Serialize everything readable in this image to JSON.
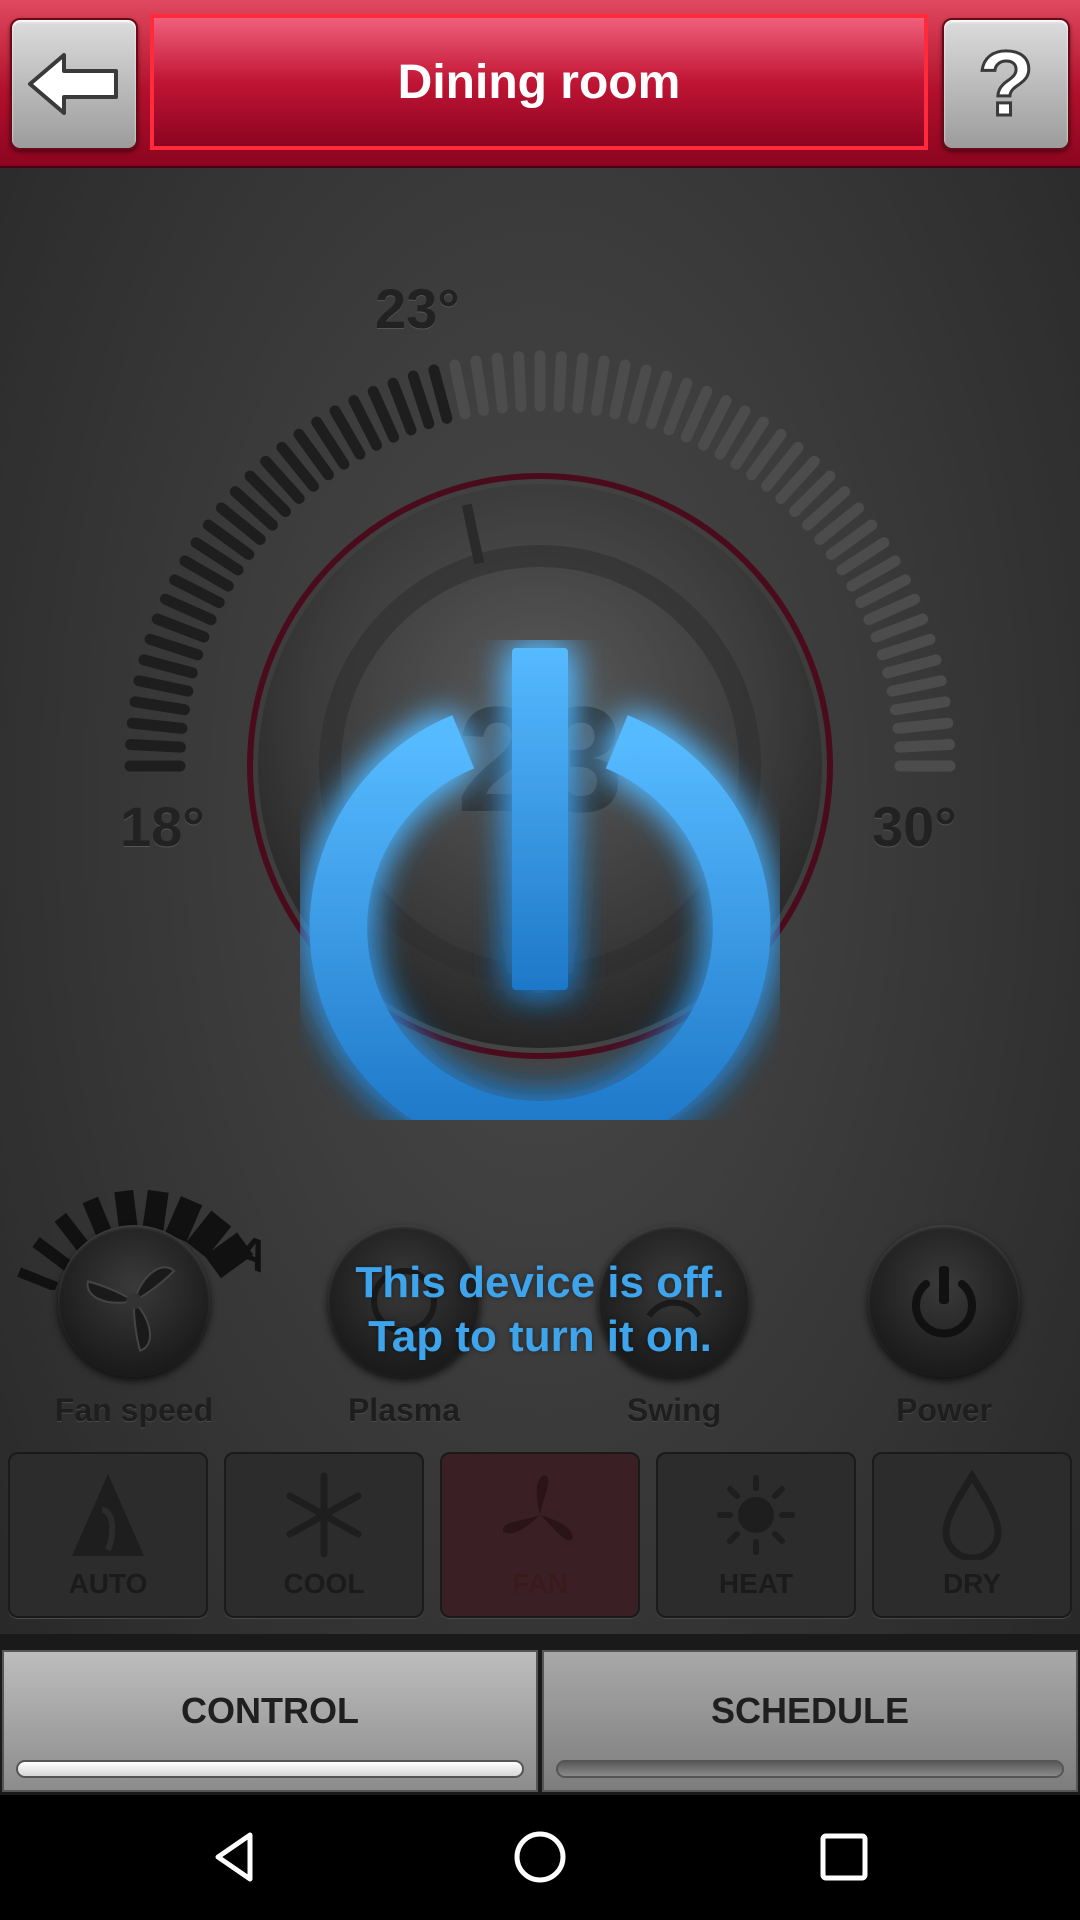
{
  "header": {
    "title": "Dining room",
    "help_label": "?"
  },
  "dial": {
    "setpoint_label": "23°",
    "min_label": "18°",
    "max_label": "30°",
    "center_value": "23",
    "setpoint": 23,
    "min": 18,
    "max": 30
  },
  "overlay": {
    "line1": "This device is off.",
    "line2": "Tap to turn it on."
  },
  "features": [
    {
      "label": "Fan speed",
      "icon": "fan-icon"
    },
    {
      "label": "Plasma",
      "icon": "plasma-icon"
    },
    {
      "label": "Swing",
      "icon": "swing-icon"
    },
    {
      "label": "Power",
      "icon": "power-icon"
    }
  ],
  "fan_speed_indicator": "A",
  "modes": [
    {
      "label": "AUTO",
      "icon": "auto-icon",
      "active": false
    },
    {
      "label": "COOL",
      "icon": "snowflake-icon",
      "active": false
    },
    {
      "label": "FAN",
      "icon": "fan-icon",
      "active": true
    },
    {
      "label": "HEAT",
      "icon": "sun-icon",
      "active": false
    },
    {
      "label": "DRY",
      "icon": "droplet-icon",
      "active": false
    }
  ],
  "tabs": [
    {
      "label": "CONTROL",
      "selected": true
    },
    {
      "label": "SCHEDULE",
      "selected": false
    }
  ],
  "colors": {
    "header_red": "#b2102c",
    "accent_blue": "#3ea4ec",
    "title_border": "#ff2a3c"
  }
}
